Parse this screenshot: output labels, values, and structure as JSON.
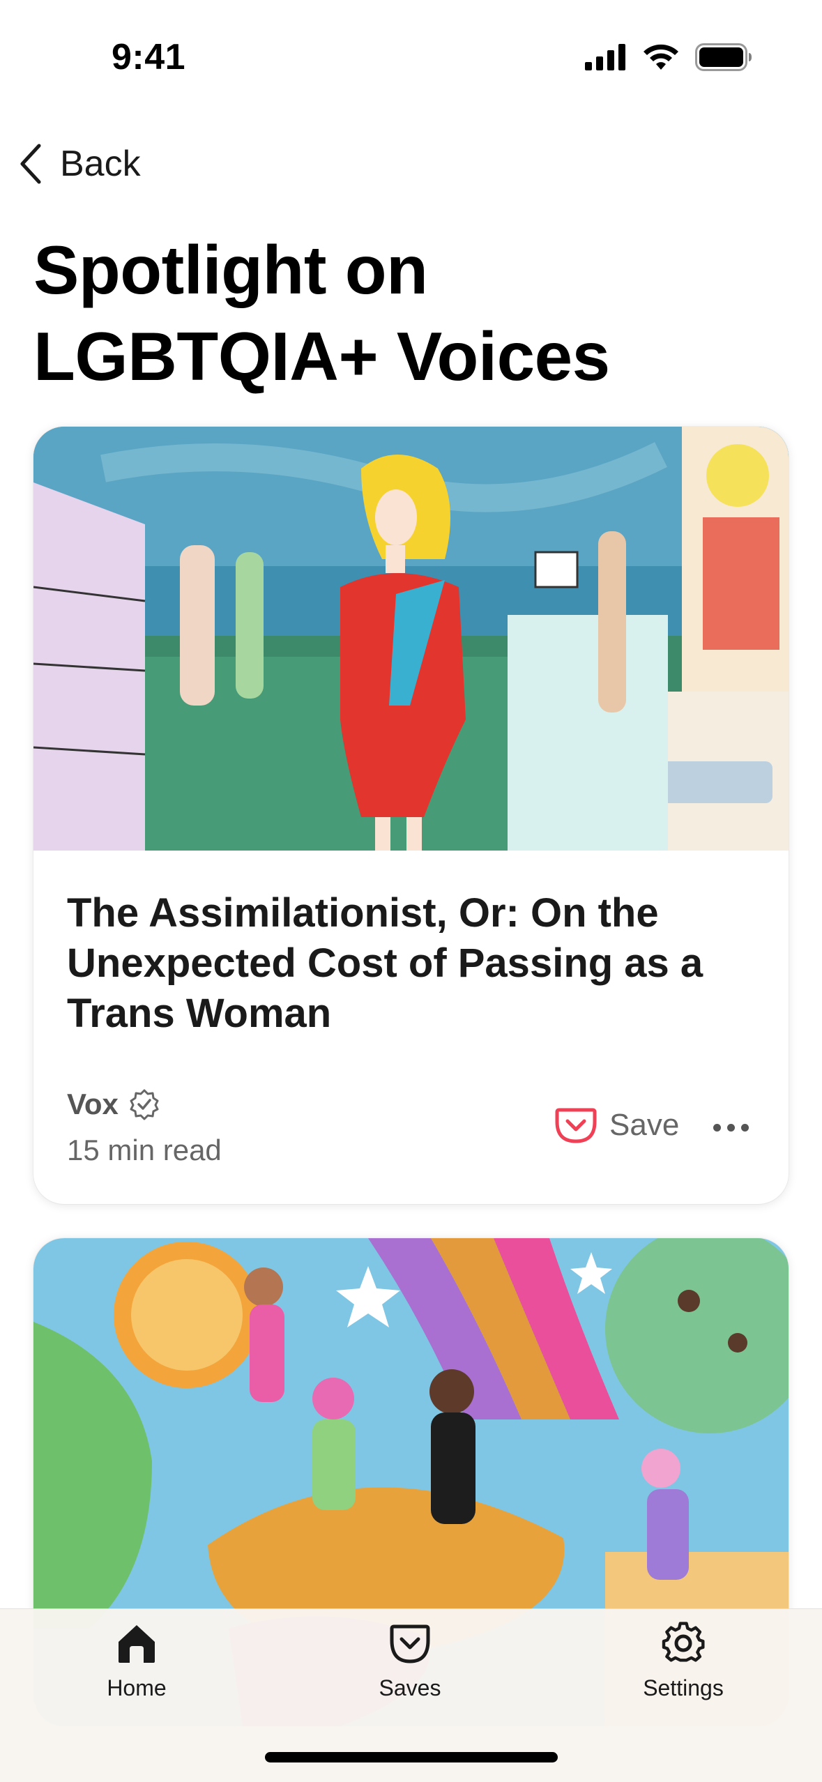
{
  "status_bar": {
    "time": "9:41"
  },
  "nav": {
    "back_label": "Back"
  },
  "page": {
    "title": "Spotlight on LGBTQIA+ Voices"
  },
  "articles": [
    {
      "title": "The Assimilationist, Or: On the Unexpected Cost of Passing as a Trans Woman",
      "publisher": "Vox",
      "verified": true,
      "read_time": "15 min read",
      "save_label": "Save",
      "image_icon": "illustration-woman-in-red-dress"
    },
    {
      "image_icon": "illustration-pride-celebration"
    }
  ],
  "tab_bar": {
    "tabs": [
      {
        "label": "Home",
        "icon": "home-icon",
        "active": true
      },
      {
        "label": "Saves",
        "icon": "pocket-icon"
      },
      {
        "label": "Settings",
        "icon": "gear-icon"
      }
    ]
  },
  "colors": {
    "accent": "#EF4056",
    "text": "#1a1a1a",
    "muted": "#666666",
    "tab_bg": "#F8F5F0"
  }
}
